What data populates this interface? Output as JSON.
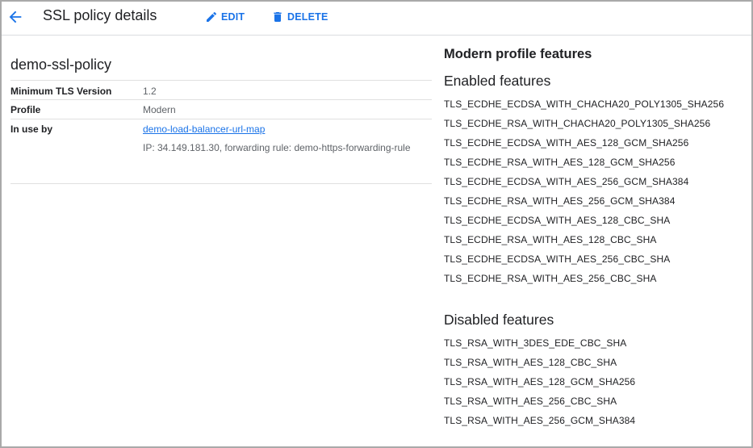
{
  "header": {
    "title": "SSL policy details",
    "edit_label": "EDIT",
    "delete_label": "DELETE"
  },
  "policy": {
    "name": "demo-ssl-policy",
    "rows": {
      "tls": {
        "label": "Minimum TLS Version",
        "value": "1.2"
      },
      "profile": {
        "label": "Profile",
        "value": "Modern"
      },
      "in_use": {
        "label": "In use by",
        "link": "demo-load-balancer-url-map",
        "detail": "IP: 34.149.181.30, forwarding rule: demo-https-forwarding-rule"
      }
    }
  },
  "features": {
    "title": "Modern profile features",
    "enabled_title": "Enabled features",
    "enabled": [
      "TLS_ECDHE_ECDSA_WITH_CHACHA20_POLY1305_SHA256",
      "TLS_ECDHE_RSA_WITH_CHACHA20_POLY1305_SHA256",
      "TLS_ECDHE_ECDSA_WITH_AES_128_GCM_SHA256",
      "TLS_ECDHE_RSA_WITH_AES_128_GCM_SHA256",
      "TLS_ECDHE_ECDSA_WITH_AES_256_GCM_SHA384",
      "TLS_ECDHE_RSA_WITH_AES_256_GCM_SHA384",
      "TLS_ECDHE_ECDSA_WITH_AES_128_CBC_SHA",
      "TLS_ECDHE_RSA_WITH_AES_128_CBC_SHA",
      "TLS_ECDHE_ECDSA_WITH_AES_256_CBC_SHA",
      "TLS_ECDHE_RSA_WITH_AES_256_CBC_SHA"
    ],
    "disabled_title": "Disabled features",
    "disabled": [
      "TLS_RSA_WITH_3DES_EDE_CBC_SHA",
      "TLS_RSA_WITH_AES_128_CBC_SHA",
      "TLS_RSA_WITH_AES_128_GCM_SHA256",
      "TLS_RSA_WITH_AES_256_CBC_SHA",
      "TLS_RSA_WITH_AES_256_GCM_SHA384"
    ]
  },
  "icons": {
    "back": "arrow-back-icon",
    "edit": "pencil-icon",
    "delete": "trash-icon"
  },
  "colors": {
    "accent": "#1a73e8",
    "text": "#202124",
    "secondary_text": "#5f6368"
  }
}
